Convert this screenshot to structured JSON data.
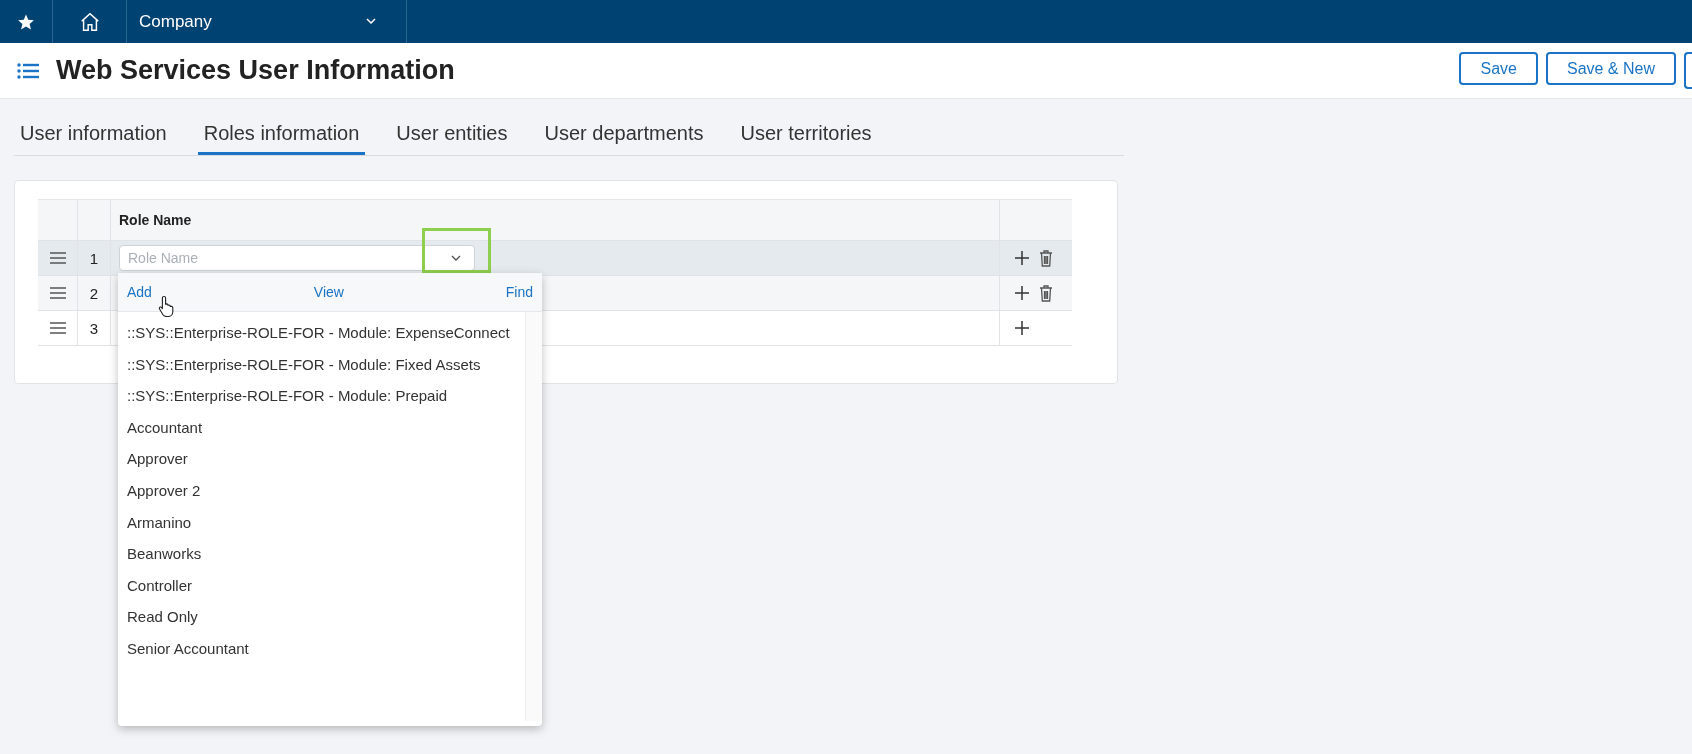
{
  "topbar": {
    "company": "Company"
  },
  "page": {
    "title": "Web Services User Information"
  },
  "buttons": [
    "Save",
    "Save & New"
  ],
  "tabs": [
    {
      "label": "User information",
      "selected": false
    },
    {
      "label": "Roles information",
      "selected": true
    },
    {
      "label": "User entities",
      "selected": false
    },
    {
      "label": "User departments",
      "selected": false
    },
    {
      "label": "User territories",
      "selected": false
    }
  ],
  "table": {
    "columns": [
      "Role Name"
    ],
    "rows": [
      {
        "number": "1",
        "selected": true,
        "deletable": true
      },
      {
        "number": "2",
        "selected": false,
        "deletable": true
      },
      {
        "number": "3",
        "selected": false,
        "deletable": false
      }
    ]
  },
  "field": {
    "placeholder": "Role Name"
  },
  "dropdown": {
    "actions": [
      "Add",
      "View",
      "Find"
    ],
    "options": [
      "::SYS::Enterprise-ROLE-FOR - Module: ExpenseConnect",
      "::SYS::Enterprise-ROLE-FOR - Module: Fixed Assets",
      "::SYS::Enterprise-ROLE-FOR - Module: Prepaid",
      "Accountant",
      "Approver",
      "Approver 2",
      "Armanino",
      "Beanworks",
      "Controller",
      "Read Only",
      "Senior Accountant"
    ]
  }
}
